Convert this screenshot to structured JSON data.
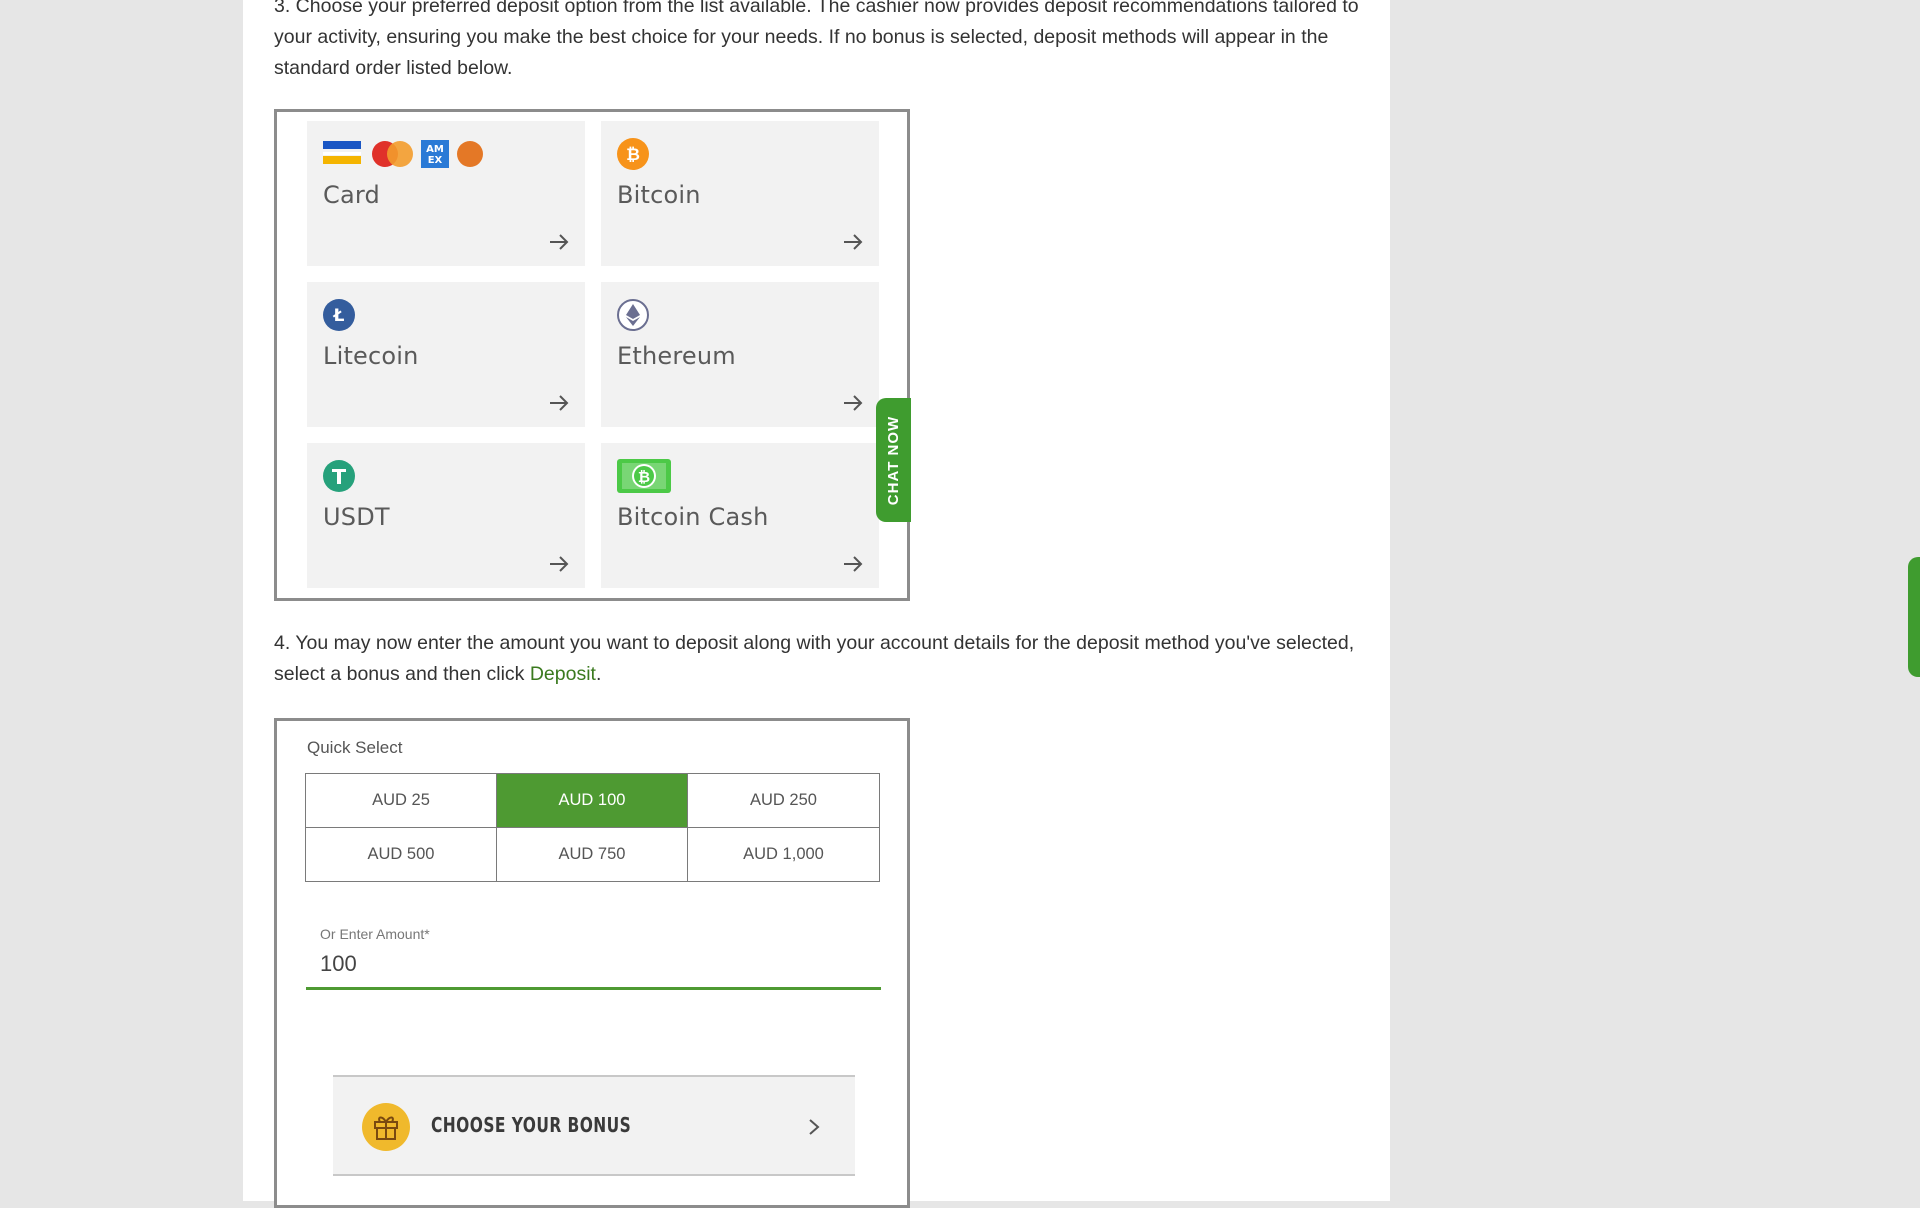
{
  "article": {
    "step3": "3. Choose your preferred deposit option from the list available. The cashier now provides deposit recommendations tailored to your activity, ensuring you make the best choice for your needs. If no bonus is selected, deposit methods will appear in the standard order listed below.",
    "step4_prefix": "4. You may now enter the amount you want to deposit along with your account details for the deposit method you've selected, select a bonus and then click ",
    "step4_link": "Deposit",
    "step4_suffix": "."
  },
  "deposit_methods": [
    {
      "label": "Card",
      "icon": "card-brands-icon"
    },
    {
      "label": "Bitcoin",
      "icon": "bitcoin-icon"
    },
    {
      "label": "Litecoin",
      "icon": "litecoin-icon"
    },
    {
      "label": "Ethereum",
      "icon": "ethereum-icon"
    },
    {
      "label": "USDT",
      "icon": "tether-icon"
    },
    {
      "label": "Bitcoin Cash",
      "icon": "bitcoin-cash-icon"
    }
  ],
  "chat": {
    "label": "CHAT NOW"
  },
  "amount_form": {
    "quick_select_label": "Quick Select",
    "options": [
      "AUD 25",
      "AUD 100",
      "AUD 250",
      "AUD 500",
      "AUD 750",
      "AUD 1,000"
    ],
    "selected": "AUD 100",
    "enter_label": "Or Enter Amount*",
    "enter_value": "100",
    "bonus_label": "CHOOSE YOUR BONUS"
  },
  "colors": {
    "accent_green": "#4e9a32",
    "chat_green": "#3f9c2f",
    "bitcoin_orange": "#f7931a",
    "litecoin_blue": "#345d9d",
    "tether_green": "#26a17b",
    "bch_green": "#4cc947",
    "gift_yellow": "#f0b92c"
  }
}
